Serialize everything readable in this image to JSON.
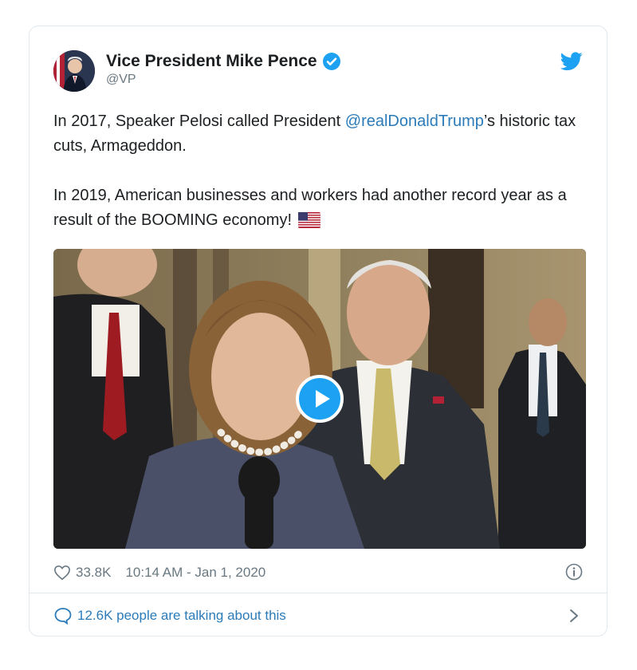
{
  "tweet": {
    "display_name": "Vice President Mike Pence",
    "handle": "@VP",
    "verified": true,
    "text": {
      "line1_pre": "In 2017, Speaker Pelosi called President ",
      "mention": "@realDonaldTrump",
      "line1_post": "’s historic tax cuts, Armageddon.",
      "para2": "In 2019, American businesses and workers had another record year as a result of the BOOMING economy!"
    },
    "likes": "33.8K",
    "timestamp": "10:14 AM - Jan 1, 2020",
    "talking": "12.6K people are talking about this"
  },
  "icons": {
    "bird": "twitter-bird-icon",
    "verified": "verified-badge-icon",
    "flag": "us-flag-emoji",
    "play": "play-icon",
    "heart": "heart-icon",
    "info": "info-icon",
    "bubble": "comment-bubble-icon",
    "chevron": "chevron-right-icon"
  },
  "colors": {
    "link": "#2b7bb9",
    "brand": "#1da1f2",
    "muted": "#697882",
    "border": "#e1e8ed"
  }
}
